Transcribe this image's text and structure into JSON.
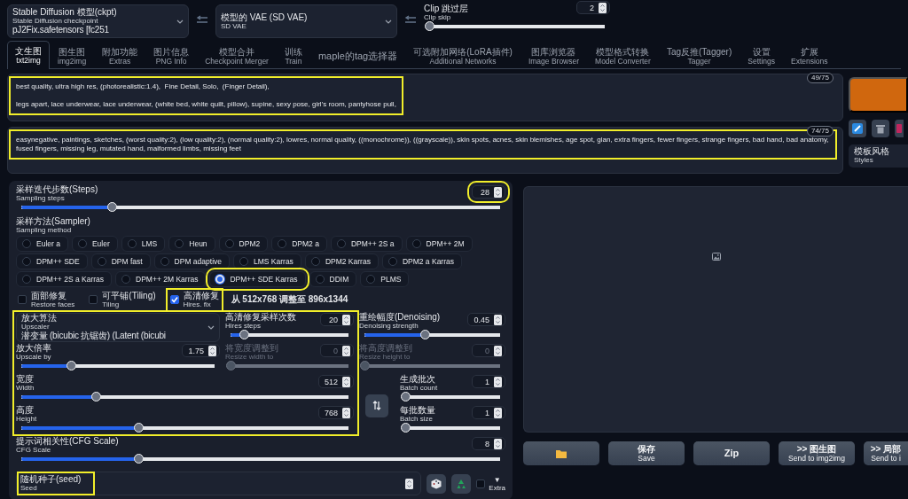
{
  "top_bar": {
    "checkpoint": {
      "label": "Stable Diffusion 模型(ckpt)",
      "sublabel": "Stable Diffusion checkpoint",
      "value": "pJ2Fix.safetensors [fc251"
    },
    "vae": {
      "label": "模型的 VAE (SD VAE)",
      "sublabel": "SD VAE"
    },
    "clip_skip": {
      "label": "Clip 跳过层",
      "sublabel": "Clip skip",
      "value": "2",
      "level": 0
    }
  },
  "tabs": [
    {
      "label": "文生图",
      "sublabel": "txt2img",
      "selected": true
    },
    {
      "label": "图生图",
      "sublabel": "img2img",
      "selected": false
    },
    {
      "label": "附加功能",
      "sublabel": "Extras",
      "selected": false
    },
    {
      "label": "图片信息",
      "sublabel": "PNG Info",
      "selected": false
    },
    {
      "label": "模型合并",
      "sublabel": "Checkpoint Merger",
      "selected": false
    },
    {
      "label": "训练",
      "sublabel": "Train",
      "selected": false
    },
    {
      "label": "maple的tag选择器",
      "selected": false
    },
    {
      "label": "可选附加网络(LoRA插件)",
      "sublabel": "Additional Networks",
      "selected": false
    },
    {
      "label": "图库浏览器",
      "sublabel": "Image Browser",
      "selected": false
    },
    {
      "label": "模型格式转换",
      "sublabel": "Model Converter",
      "selected": false
    },
    {
      "label": "Tag反推(Tagger)",
      "sublabel": "Tagger",
      "selected": false
    },
    {
      "label": "设置",
      "sublabel": "Settings",
      "selected": false
    },
    {
      "label": "扩展",
      "sublabel": "Extensions",
      "selected": false
    }
  ],
  "prompt": {
    "text": "best quality, ultra high res, (photorealistic:1.4),  Fine Detail, Solo,  (Finger Detail),\n\nlegs apart, lace underwear, lace underwear, (white bed, white quilt, pillow), supine, sexy pose, girl's room, pantyhose pull,",
    "counter": "49/75",
    "highlighted": true
  },
  "negative_prompt": {
    "text": "easynegative, paintings, sketches, (worst quality:2), (low quality:2), (normal quality:2), lowres, normal quality, ((monochrome)), ((grayscale)), skin spots, acnes, skin blemishes, age spot, glan, extra fingers, fewer fingers, strange fingers, bad hand, bad anatomy, fused fingers, missing leg, mutated hand, malformed limbs, missing feet",
    "counter": "74/75",
    "highlighted": true
  },
  "styles": {
    "label": "模板风格",
    "sublabel": "Styles"
  },
  "generation": {
    "steps": {
      "label": "采样迭代步数(Steps)",
      "sublabel": "Sampling steps",
      "value": "28",
      "level": 0.19,
      "highlighted": true
    },
    "sampler": {
      "label": "采样方法(Sampler)",
      "sublabel": "Sampling method",
      "options": [
        {
          "label": "Euler a",
          "selected": false,
          "highlighted": false
        },
        {
          "label": "Euler",
          "selected": false,
          "highlighted": false
        },
        {
          "label": "LMS",
          "selected": false,
          "highlighted": false
        },
        {
          "label": "Heun",
          "selected": false,
          "highlighted": false
        },
        {
          "label": "DPM2",
          "selected": false,
          "highlighted": false
        },
        {
          "label": "DPM2 a",
          "selected": false,
          "highlighted": false
        },
        {
          "label": "DPM++ 2S a",
          "selected": false,
          "highlighted": false
        },
        {
          "label": "DPM++ 2M",
          "selected": false,
          "highlighted": false
        },
        {
          "label": "DPM++ SDE",
          "selected": false,
          "highlighted": false
        },
        {
          "label": "DPM fast",
          "selected": false,
          "highlighted": false
        },
        {
          "label": "DPM adaptive",
          "selected": false,
          "highlighted": false
        },
        {
          "label": "LMS Karras",
          "selected": false,
          "highlighted": false
        },
        {
          "label": "DPM2 Karras",
          "selected": false,
          "highlighted": false
        },
        {
          "label": "DPM2 a Karras",
          "selected": false,
          "highlighted": false
        },
        {
          "label": "DPM++ 2S a Karras",
          "selected": false,
          "highlighted": false
        },
        {
          "label": "DPM++ 2M Karras",
          "selected": false,
          "highlighted": false
        },
        {
          "label": "DPM++ SDE Karras",
          "selected": true,
          "highlighted": true
        },
        {
          "label": "DDIM",
          "selected": false,
          "highlighted": false
        },
        {
          "label": "PLMS",
          "selected": false,
          "highlighted": false
        }
      ]
    },
    "options": [
      {
        "label": "面部修复",
        "sublabel": "Restore faces",
        "checked": false,
        "highlighted": false
      },
      {
        "label": "可平铺(Tiling)",
        "sublabel": "Tiling",
        "checked": false,
        "highlighted": false
      },
      {
        "label": "高清修复",
        "sublabel": "Hires. fix",
        "checked": true,
        "highlighted": true
      }
    ],
    "resize_note": "从 512x768 调整至 896x1344",
    "hires": {
      "highlighted": true,
      "upscaler": {
        "label": "放大算法",
        "sublabel": "Upscaler",
        "value": "潜变量 (bicubic 抗锯齿) (Latent (bicubi"
      },
      "hires_steps": {
        "label": "高清修复采样次数",
        "sublabel": "Hires steps",
        "value": "20",
        "level": 0.12,
        "disabled": false
      },
      "denoising": {
        "label": "重绘幅度(Denoising)",
        "sublabel": "Denoising strength",
        "value": "0.45",
        "level": 0.45,
        "disabled": false
      },
      "upscale_by": {
        "label": "放大倍率",
        "sublabel": "Upscale by",
        "value": "1.75",
        "level": 0.26,
        "disabled": false
      },
      "resize_width": {
        "label": "将宽度调整到",
        "sublabel": "Resize width to",
        "value": "0",
        "level": 0,
        "disabled": true
      },
      "resize_height": {
        "label": "将高度调整到",
        "sublabel": "Resize height to",
        "value": "0",
        "level": 0,
        "disabled": true
      }
    },
    "width": {
      "label": "宽度",
      "sublabel": "Width",
      "value": "512",
      "level": 0.23
    },
    "height": {
      "label": "高度",
      "sublabel": "Height",
      "value": "768",
      "level": 0.36
    },
    "batch_count": {
      "label": "生成批次",
      "sublabel": "Batch count",
      "value": "1",
      "level": 0
    },
    "batch_size": {
      "label": "每批数量",
      "sublabel": "Batch size",
      "value": "1",
      "level": 0
    },
    "cfg_scale": {
      "label": "提示词相关性(CFG Scale)",
      "sublabel": "CFG Scale",
      "value": "8",
      "level": 0.245
    },
    "seed": {
      "label": "随机种子(seed)",
      "sublabel": "Seed",
      "highlighted": true
    },
    "extra": {
      "arrow": "▼",
      "label": "Extra",
      "checked": false
    }
  },
  "output_buttons": [
    {
      "kind": "icon"
    },
    {
      "kind": "text",
      "label": "保存",
      "sublabel": "Save"
    },
    {
      "kind": "text",
      "label": "Zip"
    },
    {
      "kind": "text",
      "label": ">> 图生图",
      "sublabel": "Send to img2img"
    },
    {
      "kind": "text",
      "label": ">> 局部",
      "sublabel": "Send to i"
    }
  ]
}
